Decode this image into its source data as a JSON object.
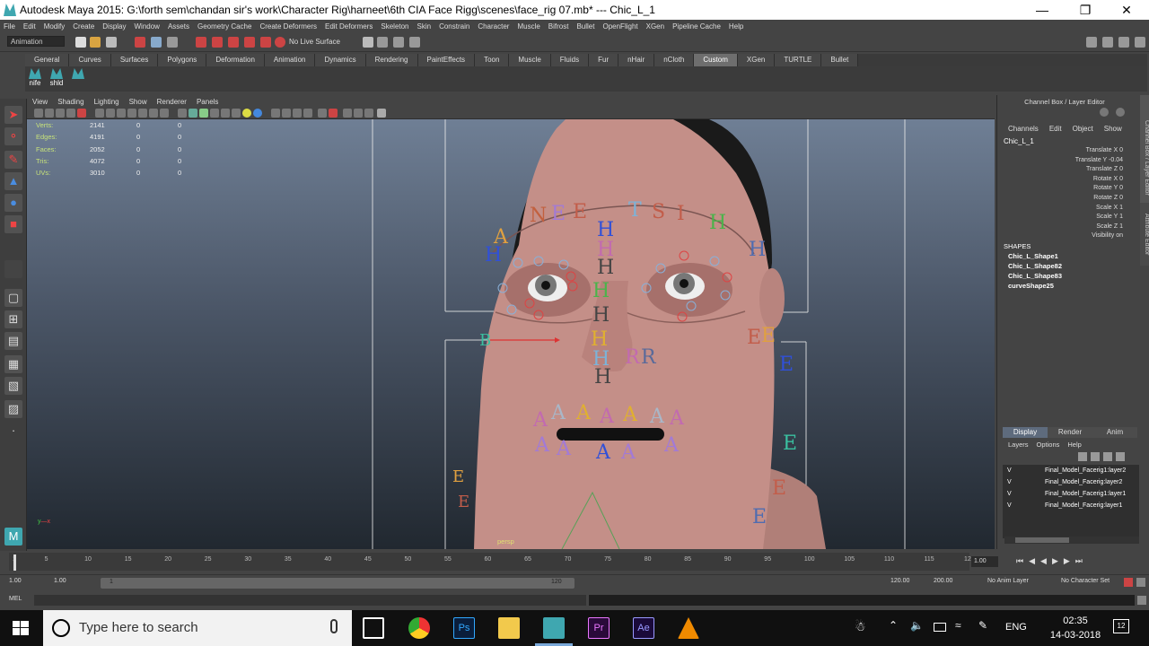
{
  "titlebar": {
    "title": "Autodesk Maya 2015: G:\\forth sem\\chandan sir's work\\Character Rig\\harneet\\6th CIA Face Rigg\\scenes\\face_rig 07.mb*   ---   Chic_L_1"
  },
  "menubar": {
    "items": [
      "File",
      "Edit",
      "Modify",
      "Create",
      "Display",
      "Window",
      "Assets",
      "Geometry Cache",
      "Create Deformers",
      "Edit Deformers",
      "Skeleton",
      "Skin",
      "Constrain",
      "Character",
      "Muscle",
      "Bifrost",
      "Bullet",
      "OpenFlight",
      "XGen",
      "Pipeline Cache",
      "Help"
    ]
  },
  "statusline": {
    "mode": "Animation",
    "live_surface": "No Live Surface"
  },
  "shelf": {
    "tabs": [
      "General",
      "Curves",
      "Surfaces",
      "Polygons",
      "Deformation",
      "Animation",
      "Dynamics",
      "Rendering",
      "PaintEffects",
      "Toon",
      "Muscle",
      "Fluids",
      "Fur",
      "nHair",
      "nCloth",
      "Custom",
      "XGen",
      "TURTLE",
      "Bullet"
    ],
    "active_tab": "Custom",
    "items": [
      {
        "label": "nife"
      },
      {
        "label": "shld"
      },
      {
        "label": ""
      }
    ]
  },
  "viewport": {
    "menu": [
      "View",
      "Shading",
      "Lighting",
      "Show",
      "Renderer",
      "Panels"
    ],
    "hud": [
      {
        "label": "Verts:",
        "value": "2141",
        "a": "0",
        "b": "0"
      },
      {
        "label": "Edges:",
        "value": "4191",
        "a": "0",
        "b": "0"
      },
      {
        "label": "Faces:",
        "value": "2052",
        "a": "0",
        "b": "0"
      },
      {
        "label": "Tris:",
        "value": "4072",
        "a": "0",
        "b": "0"
      },
      {
        "label": "UVs:",
        "value": "3010",
        "a": "0",
        "b": "0"
      }
    ],
    "camera": "persp"
  },
  "channel_box": {
    "title": "Channel Box / Layer Editor",
    "menu": [
      "Channels",
      "Edit",
      "Object",
      "Show"
    ],
    "object": "Chic_L_1",
    "attributes": [
      {
        "name": "Translate X",
        "value": "0"
      },
      {
        "name": "Translate Y",
        "value": "-0.04"
      },
      {
        "name": "Translate Z",
        "value": "0"
      },
      {
        "name": "Rotate X",
        "value": "0"
      },
      {
        "name": "Rotate Y",
        "value": "0"
      },
      {
        "name": "Rotate Z",
        "value": "0"
      },
      {
        "name": "Scale X",
        "value": "1"
      },
      {
        "name": "Scale Y",
        "value": "1"
      },
      {
        "name": "Scale Z",
        "value": "1"
      },
      {
        "name": "Visibility",
        "value": "on"
      }
    ],
    "shapes_header": "SHAPES",
    "shapes": [
      "Chic_L_Shape1",
      "Chic_L_Shape82",
      "Chic_L_Shape83",
      "curveShape25"
    ]
  },
  "layer_editor": {
    "tabs": [
      "Display",
      "Render",
      "Anim"
    ],
    "active_tab": "Display",
    "menu": [
      "Layers",
      "Options",
      "Help"
    ],
    "layers": [
      {
        "vis": "V",
        "name": "Final_Model_Facerig1:layer2"
      },
      {
        "vis": "V",
        "name": "Final_Model_Facerig:layer2"
      },
      {
        "vis": "V",
        "name": "Final_Model_Facerig1:layer1"
      },
      {
        "vis": "V",
        "name": "Final_Model_Facerig:layer1"
      }
    ]
  },
  "timeline": {
    "ticks": [
      "1",
      "5",
      "10",
      "15",
      "20",
      "25",
      "30",
      "35",
      "40",
      "45",
      "50",
      "55",
      "60",
      "65",
      "70",
      "75",
      "80",
      "85",
      "90",
      "95",
      "100",
      "105",
      "110",
      "115",
      "120"
    ],
    "current_frame": "1.00"
  },
  "range": {
    "start": "1.00",
    "start2": "1.00",
    "slider_start": "1",
    "slider_end": "120",
    "end": "120.00",
    "end2": "200.00",
    "anim_layer": "No Anim Layer",
    "char_set": "No Character Set"
  },
  "mel": {
    "label": "MEL"
  },
  "taskbar": {
    "search_placeholder": "Type here to search",
    "time": "02:35",
    "date": "14-03-2018",
    "lang": "ENG",
    "notifications": "12"
  },
  "colors": {
    "maya_teal": "#3fa7b0",
    "accent_blue": "#5e6b7d",
    "active_tab": "#6e6e6e"
  }
}
